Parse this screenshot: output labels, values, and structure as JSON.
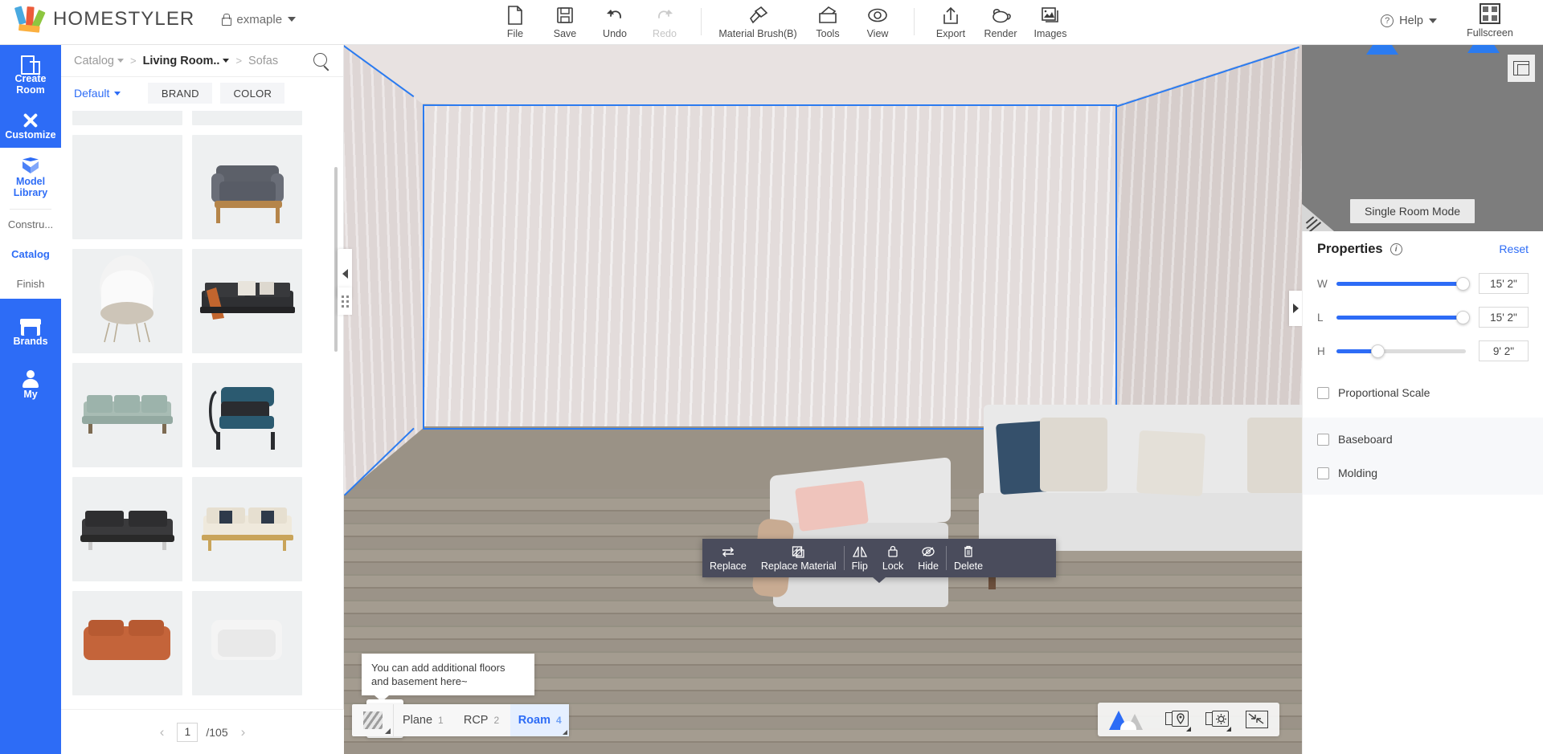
{
  "app": {
    "brand": "HOMESTYLER",
    "project_name": "exmaple",
    "lock_icon": "lock-icon"
  },
  "toolbar": {
    "items": [
      {
        "label": "File",
        "icon": "file-icon",
        "disabled": false,
        "dropdown": true
      },
      {
        "label": "Save",
        "icon": "save-icon",
        "disabled": false,
        "dropdown": false
      },
      {
        "label": "Undo",
        "icon": "undo-icon",
        "disabled": false,
        "dropdown": false
      },
      {
        "label": "Redo",
        "icon": "redo-icon",
        "disabled": true,
        "dropdown": false
      },
      {
        "label": "Material Brush(B)",
        "icon": "brush-icon",
        "disabled": false,
        "dropdown": false
      },
      {
        "label": "Tools",
        "icon": "tools-icon",
        "disabled": false,
        "dropdown": true
      },
      {
        "label": "View",
        "icon": "eye-icon",
        "disabled": false,
        "dropdown": true
      },
      {
        "label": "Export",
        "icon": "export-icon",
        "disabled": false,
        "dropdown": true
      },
      {
        "label": "Render",
        "icon": "teapot-icon",
        "disabled": false,
        "dropdown": false
      },
      {
        "label": "Images",
        "icon": "images-icon",
        "disabled": false,
        "dropdown": false
      }
    ],
    "help_label": "Help",
    "fullscreen_label": "Fullscreen"
  },
  "rail": {
    "top_items": [
      {
        "label": "Create\nRoom",
        "icon": "room-icon"
      },
      {
        "label": "Customize",
        "icon": "wrench-icon"
      }
    ],
    "model_library": {
      "label": "Model\nLibrary",
      "icon": "box-icon"
    },
    "sub_items": [
      {
        "label": "Constru...",
        "active": false
      },
      {
        "label": "Catalog",
        "active": true
      },
      {
        "label": "Finish",
        "active": false
      }
    ],
    "bottom_items": [
      {
        "label": "Brands",
        "icon": "store-icon"
      },
      {
        "label": "My",
        "icon": "user-icon"
      }
    ]
  },
  "catalog": {
    "breadcrumb": [
      {
        "label": "Catalog",
        "current": false,
        "caret": true
      },
      {
        "label": "Living Room..",
        "current": true,
        "caret": true
      },
      {
        "label": "Sofas",
        "current": false,
        "caret": false
      }
    ],
    "search_icon": "search-icon",
    "sort_label": "Default",
    "filters": [
      "BRAND",
      "COLOR"
    ],
    "pagination": {
      "current": "1",
      "total": "/105",
      "prev": "‹",
      "next": "›"
    }
  },
  "viewport": {
    "context_menu": [
      {
        "label": "Replace",
        "icon": "swap-icon"
      },
      {
        "label": "Replace Material",
        "icon": "material-icon"
      },
      {
        "label": "Flip",
        "icon": "flip-icon"
      },
      {
        "label": "Lock",
        "icon": "lock-icon"
      },
      {
        "label": "Hide",
        "icon": "hide-icon"
      },
      {
        "label": "Delete",
        "icon": "trash-icon"
      }
    ],
    "tip_text": "You can add additional floors and basement here~",
    "mode_tabs": [
      {
        "label": "Plane",
        "num": "1",
        "active": false
      },
      {
        "label": "RCP",
        "num": "2",
        "active": false
      },
      {
        "label": "Roam",
        "num": "4",
        "active": true
      }
    ],
    "view_controls": [
      {
        "icon": "mountain-icon"
      },
      {
        "icon": "camera-location-icon"
      },
      {
        "icon": "camera-settings-icon"
      },
      {
        "icon": "shrink-icon"
      }
    ]
  },
  "minimap": {
    "single_room_mode": "Single Room Mode",
    "expand_icon": "expand-minimap-icon"
  },
  "properties": {
    "title": "Properties",
    "info_icon": "info-icon",
    "reset_label": "Reset",
    "sliders": [
      {
        "label": "W",
        "value": "15' 2\"",
        "percent": 98
      },
      {
        "label": "L",
        "value": "15' 2\"",
        "percent": 98
      },
      {
        "label": "H",
        "value": "9' 2\"",
        "percent": 32
      }
    ],
    "checkboxes_main": [
      {
        "label": "Proportional Scale",
        "checked": false
      }
    ],
    "checkboxes_group": [
      {
        "label": "Baseboard",
        "checked": false
      },
      {
        "label": "Molding",
        "checked": false
      }
    ]
  },
  "colors": {
    "accent": "#2d6cf6",
    "rail_bg": "#2d6cf6",
    "context_menu_bg": "#4a4c5c",
    "minimap_bg": "#7d7d7d",
    "wall": "#e3dcdb",
    "floor": "#9b9388"
  }
}
